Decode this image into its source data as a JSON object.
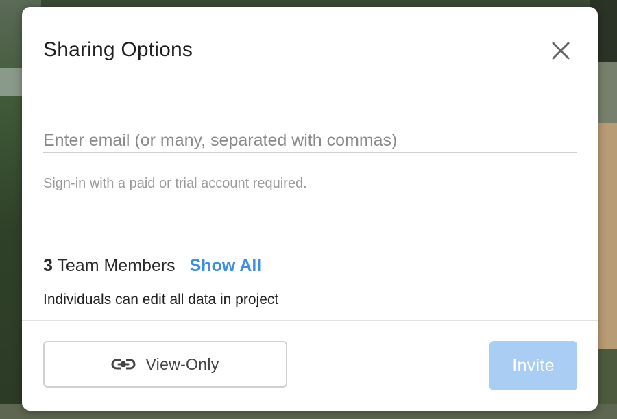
{
  "dialog": {
    "title": "Sharing Options",
    "close_icon": "close-icon"
  },
  "email": {
    "placeholder": "Enter email (or many, separated with commas)",
    "value": ""
  },
  "helper_text": "Sign-in with a paid or trial account required.",
  "team": {
    "count": "3",
    "label": "Team Members",
    "show_all_label": "Show All",
    "description": "Individuals can edit all data in project"
  },
  "footer": {
    "view_only_label": "View-Only",
    "view_only_icon": "link-icon",
    "invite_label": "Invite"
  },
  "colors": {
    "accent": "#3d8ee8",
    "invite_disabled_bg": "#a9cdf3"
  }
}
